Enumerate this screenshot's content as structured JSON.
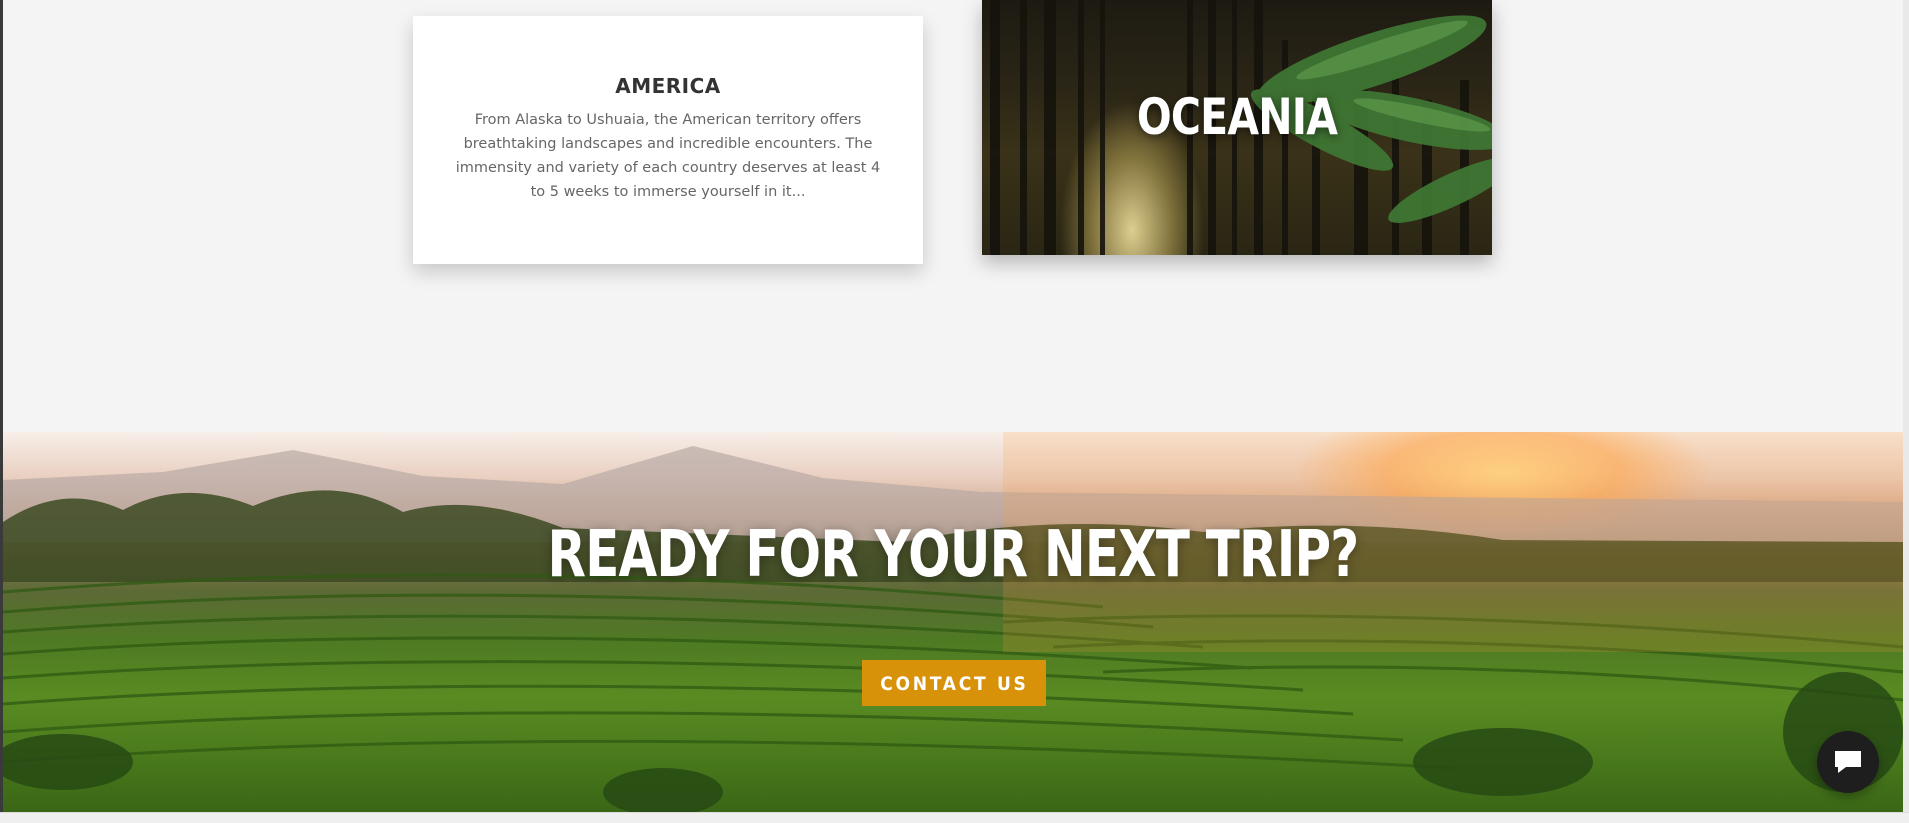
{
  "cards": {
    "america": {
      "title": "AMERICA",
      "description": "From Alaska to Ushuaia, the American territory offers breathtaking landscapes and incredible encounters. The immensity and variety of each country deserves at least 4 to 5 weeks to immerse yourself in it..."
    },
    "oceania": {
      "title": "OCEANIA"
    }
  },
  "banner": {
    "headline": "READY FOR YOUR NEXT TRIP?",
    "cta_label": "CONTACT US"
  },
  "chat": {
    "icon": "chat-bubble-icon"
  },
  "colors": {
    "accent": "#d8920a",
    "background": "#f4f4f4",
    "chat_button": "#1e1e1e"
  }
}
